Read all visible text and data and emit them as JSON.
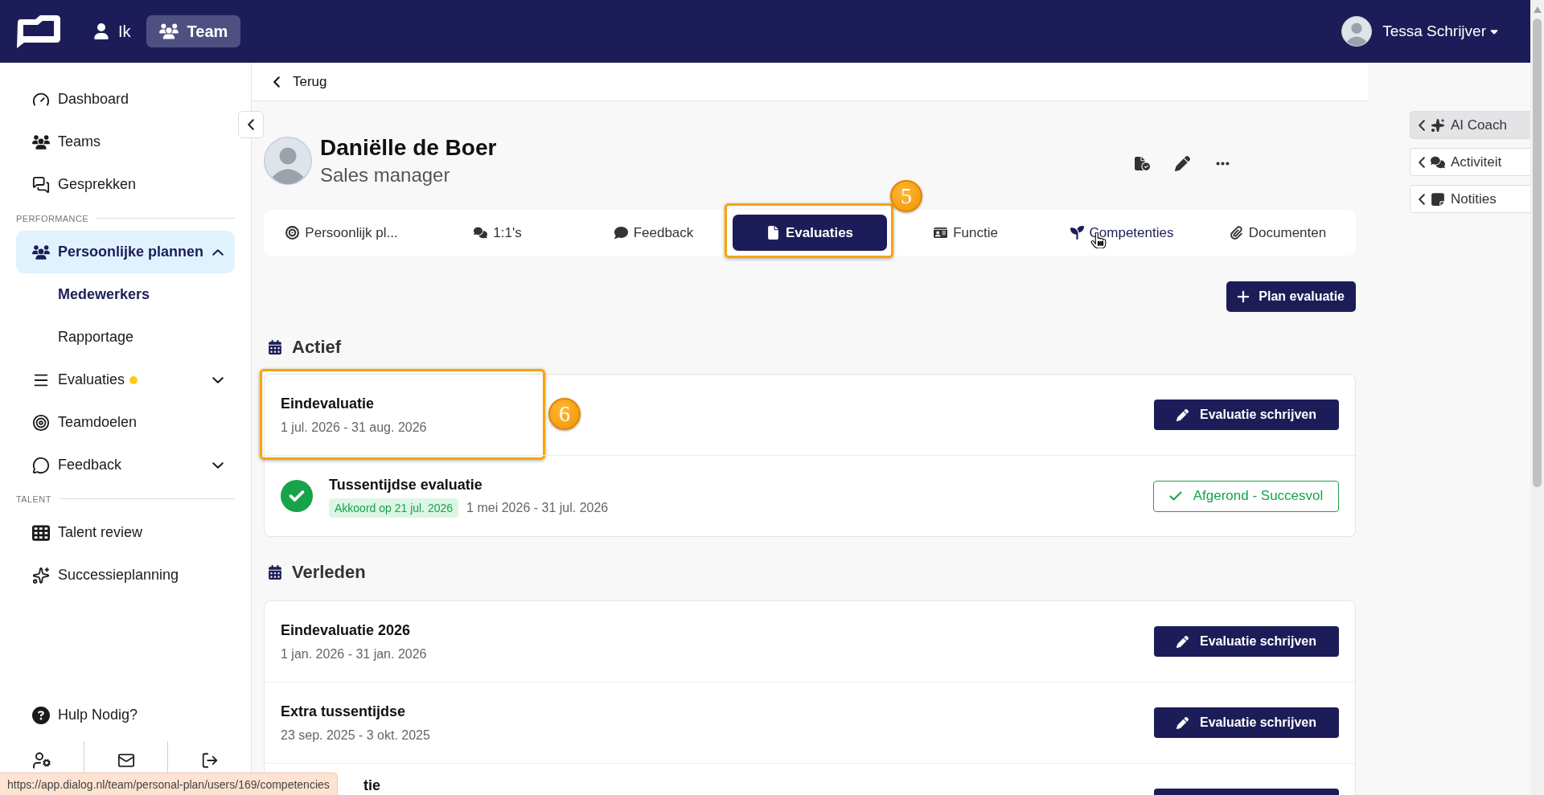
{
  "top_bar": {
    "nav": [
      {
        "label": "Ik",
        "selected": false
      },
      {
        "label": "Team",
        "selected": true
      }
    ],
    "user_name": "Tessa Schrijver"
  },
  "sidebar": {
    "top_items": [
      {
        "label": "Dashboard",
        "selected": false
      },
      {
        "label": "Teams",
        "selected": false
      },
      {
        "label": "Gesprekken",
        "selected": false
      }
    ],
    "sections": [
      {
        "title": "PERFORMANCE",
        "items": [
          {
            "kind": "group",
            "label": "Persoonlijke plannen",
            "selected": true,
            "expanded": true,
            "notification": false,
            "children": [
              {
                "label": "Medewerkers",
                "selected": true
              },
              {
                "label": "Rapportage",
                "selected": false
              }
            ]
          },
          {
            "kind": "group",
            "label": "Evaluaties",
            "selected": false,
            "expanded": false,
            "notification": true
          },
          {
            "kind": "link",
            "label": "Teamdoelen",
            "selected": false,
            "notification": false
          },
          {
            "kind": "group",
            "label": "Feedback",
            "selected": false,
            "expanded": false,
            "notification": false
          }
        ]
      },
      {
        "title": "TALENT",
        "items": [
          {
            "kind": "link",
            "label": "Talent review",
            "selected": false,
            "notification": false
          },
          {
            "kind": "link",
            "label": "Successieplanning",
            "selected": false,
            "notification": false
          }
        ]
      }
    ],
    "help_label": "Hulp Nodig?"
  },
  "back_link": "Terug",
  "profile": {
    "name": "Daniëlle de Boer",
    "role": "Sales manager"
  },
  "tabs": [
    {
      "label": "Persoonlijk pl...",
      "selected": false,
      "hovered": false
    },
    {
      "label": "1:1's",
      "selected": false,
      "hovered": false
    },
    {
      "label": "Feedback",
      "selected": false,
      "hovered": false
    },
    {
      "label": "Evaluaties",
      "selected": true,
      "hovered": false,
      "callout": "5"
    },
    {
      "label": "Functie",
      "selected": false,
      "hovered": false
    },
    {
      "label": "Competenties",
      "selected": false,
      "hovered": true
    },
    {
      "label": "Documenten",
      "selected": false,
      "hovered": false
    }
  ],
  "plan_button": "Plan evaluatie",
  "sections": [
    {
      "title": "Actief",
      "rows": [
        {
          "title": "Eindevaluatie",
          "dates": "1 jul. 2026 - 31 aug. 2026",
          "completed": false,
          "under_status_bar": false,
          "callout": "6",
          "action": {
            "kind": "button",
            "label": "Evaluatie schrijven"
          }
        },
        {
          "title": "Tussentijdse evaluatie",
          "approval": "Akkoord op 21 jul. 2026",
          "dates": "1 mei 2026 - 31 jul. 2026",
          "completed": true,
          "under_status_bar": false,
          "action": {
            "kind": "status",
            "label": "Afgerond - Succesvol"
          }
        }
      ]
    },
    {
      "title": "Verleden",
      "rows": [
        {
          "title": "Eindevaluatie 2026",
          "dates": "1 jan. 2026 - 31 jan. 2026",
          "completed": false,
          "under_status_bar": false,
          "action": {
            "kind": "button",
            "label": "Evaluatie schrijven"
          }
        },
        {
          "title": "Extra tussentijdse",
          "dates": "23 sep. 2025 - 3 okt. 2025",
          "completed": false,
          "under_status_bar": false,
          "action": {
            "kind": "button",
            "label": "Evaluatie schrijven"
          }
        },
        {
          "title": "tie",
          "completed": false,
          "under_status_bar": true,
          "action": {
            "kind": "button"
          }
        }
      ]
    }
  ],
  "side_panel": [
    {
      "label": "AI Coach",
      "selected": true
    },
    {
      "label": "Activiteit",
      "selected": false
    },
    {
      "label": "Notities",
      "selected": false
    }
  ],
  "status_url": "https://app.dialog.nl/team/personal-plan/users/169/competencies"
}
